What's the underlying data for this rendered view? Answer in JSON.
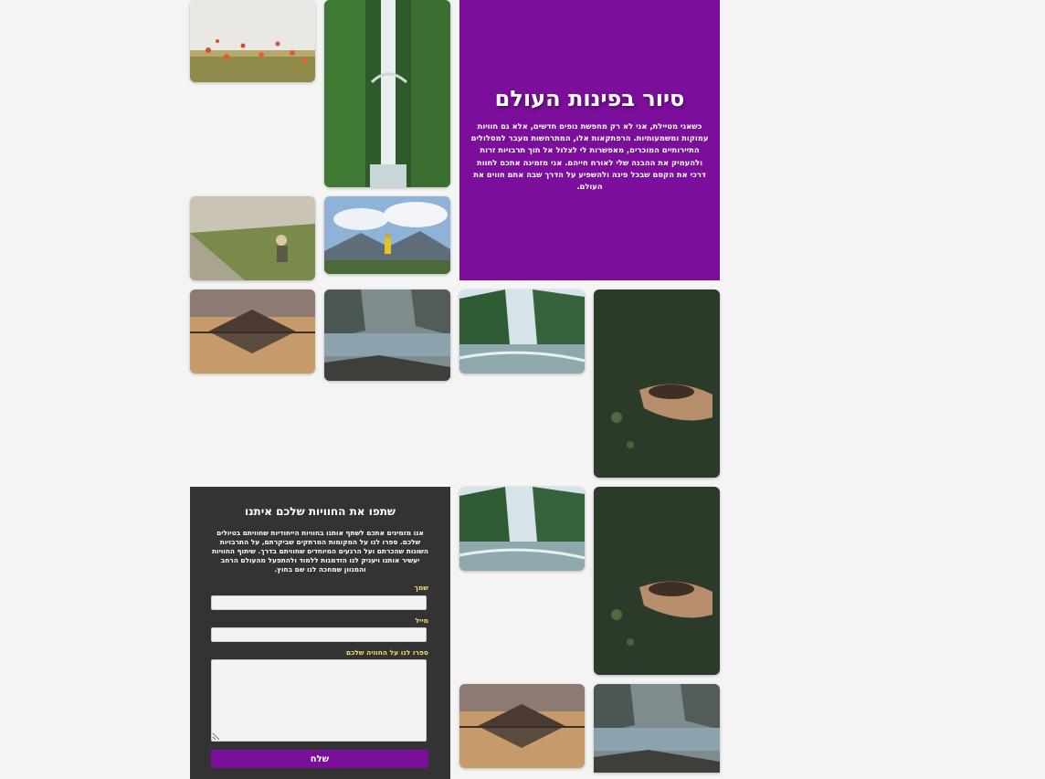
{
  "hero": {
    "title": "סיור בפינות העולם",
    "text": "כשאני מטיילת, אני לא רק מחפשת נופים חדשים, אלא גם חוויות עמוקות ומשמעותיות. הרפתקאות אלו, המתרחשות מעבר למסלולים התיירותיים המוכרים, מאפשרות לי לצלול אל תוך תרבויות זרות ולהעמיק את ההבנה שלי לאורח חייהם. אני מזמינה אתכם לחוות דרכי את הקסם שבכל פינה ולהשפיע על הדרך שבה אתם חווים את העולם."
  },
  "form": {
    "title": "שתפו את החוויות שלכם איתנו",
    "intro": "אנו מזמינים אתכם לשתף אותנו בחוויות הייחודיות שחוויתם בטיולים שלכם. ספרו לנו על המקומות המרתקים שביקרתם, על התרבויות השונות שהכרתם ועל הרגעים המיוחדים שחוויתם בדרך. שיתוף החוויות יעשיר אותנו ויעניק לנו הזדמנות ללמוד ולהתפעל מהעולם הרחב והמגוון שמחכה לנו שם בחוץ.",
    "name_label": "שמך",
    "email_label": "מייל",
    "message_label": "ספרו לנו על החוויה שלכם",
    "submit_label": "שלח"
  },
  "colors": {
    "accent": "#7b0f9b",
    "panel": "#333333",
    "label": "#ffd966",
    "background": "#f4f4f4"
  }
}
